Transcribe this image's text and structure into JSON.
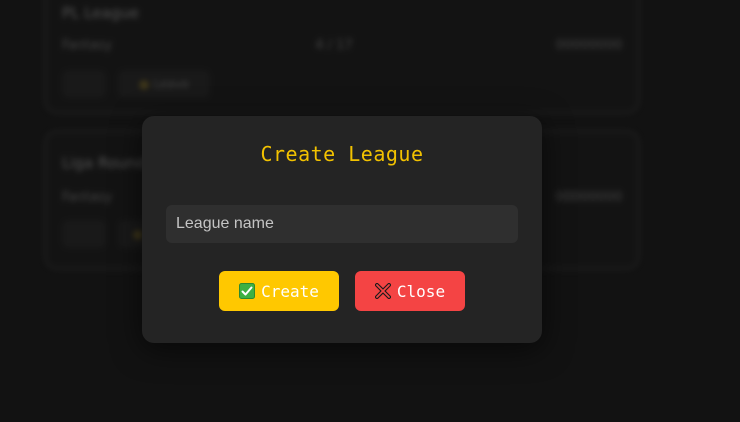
{
  "background": {
    "cards": [
      {
        "title": "PL League",
        "col1": "Fantasy",
        "col2": "4 / 17",
        "col3": "00000000",
        "btn1": "",
        "btn2": "Leave"
      },
      {
        "title": "Liga Round",
        "col1": "Fantasy",
        "col2": "",
        "col3": "00000000",
        "btn1": "",
        "btn2": ""
      }
    ]
  },
  "modal": {
    "title": "Create League",
    "input": {
      "placeholder": "League name",
      "value": ""
    },
    "create_label": "Create",
    "close_label": "Close"
  },
  "colors": {
    "accent": "#ffc800",
    "title": "#f2c200",
    "danger": "#f44444",
    "modal_bg": "#242424",
    "input_bg": "#2f2f2f",
    "page_bg": "#121212"
  },
  "icons": {
    "create": "check-mark-icon",
    "close": "cross-mark-icon"
  }
}
